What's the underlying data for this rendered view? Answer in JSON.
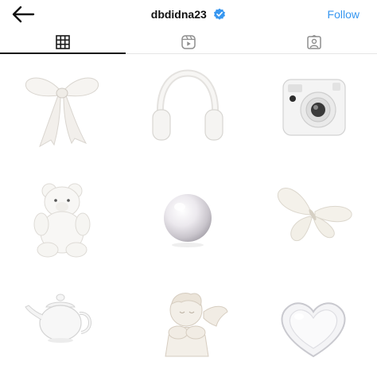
{
  "header": {
    "username": "dbdidna23",
    "follow_label": "Follow",
    "verified": true,
    "accent_color": "#3897f0"
  },
  "tabs": [
    {
      "icon": "grid-icon",
      "active": true
    },
    {
      "icon": "reels-icon",
      "active": false
    },
    {
      "icon": "tagged-icon",
      "active": false
    }
  ],
  "posts": [
    {
      "subject": "bow-icon"
    },
    {
      "subject": "headphones-icon"
    },
    {
      "subject": "instant-camera-icon"
    },
    {
      "subject": "teddy-bear-icon"
    },
    {
      "subject": "pearl-icon"
    },
    {
      "subject": "butterfly-icon"
    },
    {
      "subject": "teapot-icon"
    },
    {
      "subject": "cherub-icon"
    },
    {
      "subject": "heart-glass-icon"
    }
  ]
}
